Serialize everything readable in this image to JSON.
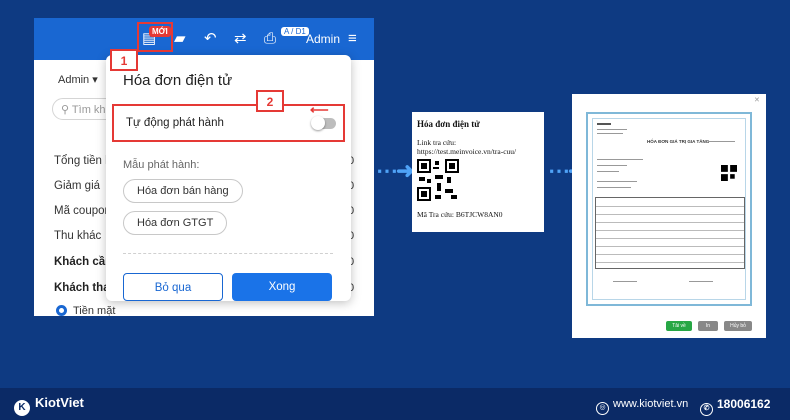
{
  "topbar": {
    "badge_new": "MỚI",
    "page_indicator": "A / D1",
    "user": "Admin",
    "icons": [
      "invoice-settings-icon",
      "bag-icon",
      "undo-icon",
      "swap-icon",
      "printer-icon",
      "menu-icon"
    ]
  },
  "pos": {
    "seller": "Admin ▾",
    "search_placeholder": "Tìm kh",
    "rows": [
      {
        "label": "Tổng tiền h",
        "value": "0"
      },
      {
        "label": "Giảm giá",
        "value": "0"
      },
      {
        "label": "Mã coupon",
        "value": "0"
      },
      {
        "label": "Thu khác",
        "value": "0"
      },
      {
        "label": "Khách cần",
        "value": "0"
      },
      {
        "label": "Khách than",
        "value": "0"
      }
    ],
    "payment_option": "Tiền mặt"
  },
  "popup": {
    "title": "Hóa đơn điện tử",
    "toggle_label": "Tự động phát hành",
    "toggle_on": false,
    "template_label": "Mẫu phát hành:",
    "templates": [
      "Hóa đơn bán hàng",
      "Hóa đơn GTGT"
    ],
    "cancel": "Bỏ qua",
    "confirm": "Xong"
  },
  "callouts": {
    "one": "1",
    "two": "2"
  },
  "qr_card": {
    "title": "Hóa đơn điện tử",
    "link_label": "Link tra cứu:",
    "link_url": "https://test.meinvoice.vn/tra-cuu/",
    "code": "Mã Tra cứu: B6TJCW8AN0"
  },
  "invoice_preview": {
    "header": "HÓA ĐƠN GIÁ TRỊ GIA TĂNG",
    "buttons": [
      "Tải về",
      "In",
      "Hủy bỏ"
    ],
    "button_colors": [
      "#27a745",
      "#888888",
      "#888888"
    ]
  },
  "footer": {
    "brand": "KiotViet",
    "website": "www.kiotviet.vn",
    "phone": "18006162"
  },
  "colors": {
    "background": "#0e3a82",
    "topbar": "#1967d2",
    "accent_red": "#e53935",
    "primary_button": "#1a73e8"
  }
}
